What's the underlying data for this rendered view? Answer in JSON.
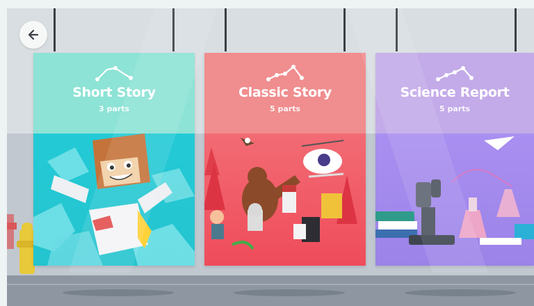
{
  "nav": {
    "back_icon": "back-arrow-icon"
  },
  "cards": [
    {
      "title": "Short Story",
      "subtitle": "3 parts",
      "icon": "story-arc-icon",
      "color": "#23cad6"
    },
    {
      "title": "Classic Story",
      "subtitle": "5 parts",
      "icon": "story-arc-icon",
      "color": "#ef4c5a"
    },
    {
      "title": "Science Report",
      "subtitle": "5 parts",
      "icon": "story-arc-icon",
      "color": "#9b83e8"
    }
  ]
}
